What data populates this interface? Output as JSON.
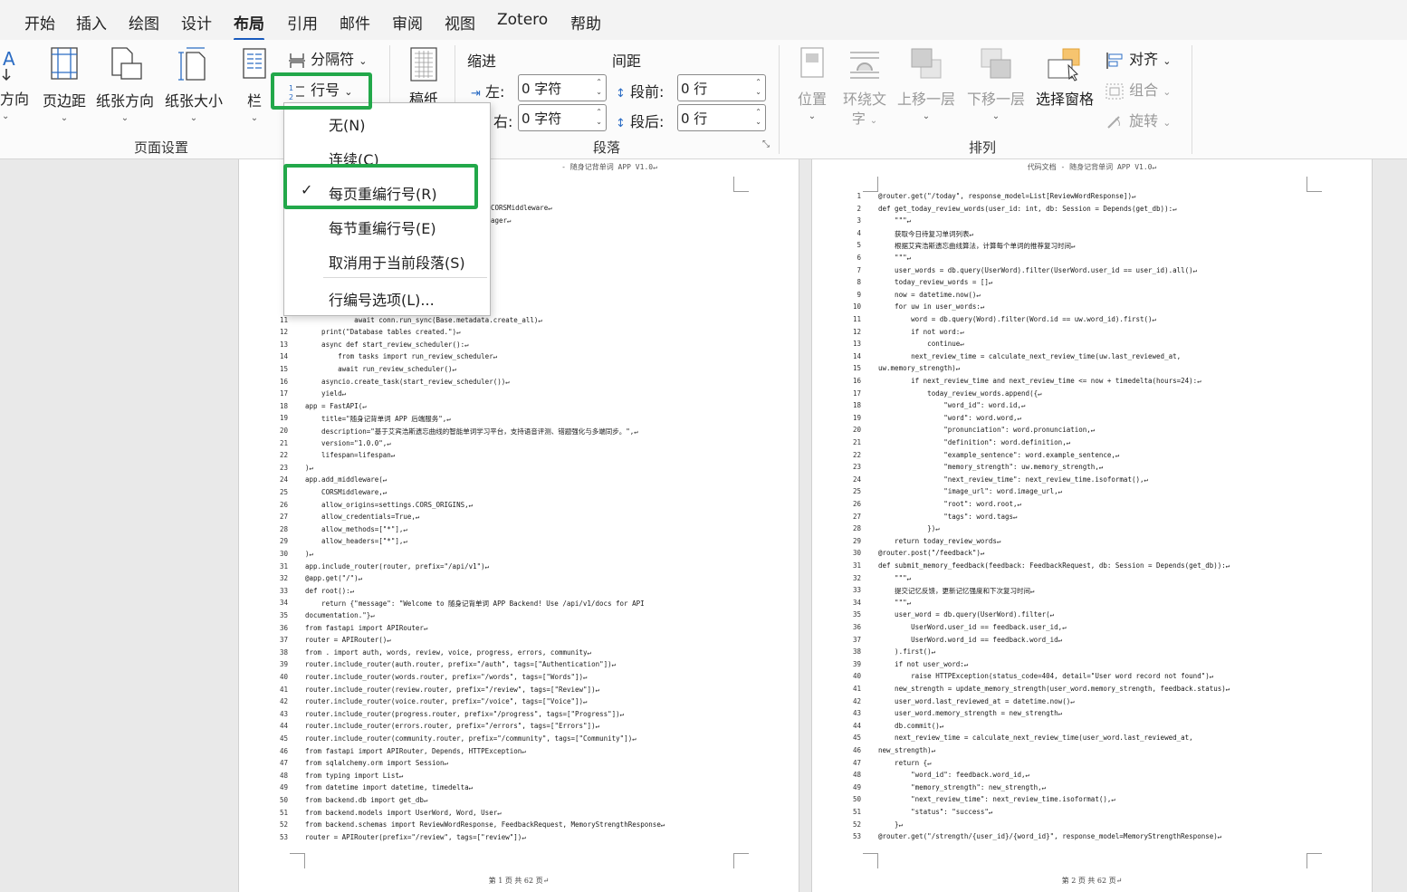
{
  "menu": [
    "开始",
    "插入",
    "绘图",
    "设计",
    "布局",
    "引用",
    "邮件",
    "审阅",
    "视图",
    "Zotero",
    "帮助"
  ],
  "active_menu": "布局",
  "ribbon": {
    "page_setup": {
      "text_direction": "方向",
      "margins": "页边距",
      "orientation": "纸张方向",
      "size": "纸张大小",
      "columns": "栏",
      "breaks": "分隔符",
      "line_numbers": "行号",
      "group_label": "页面设置"
    },
    "draft_paper": "稿纸",
    "paragraph": {
      "indent_label": "缩进",
      "spacing_label": "间距",
      "left_label": "左:",
      "left_value": "0 字符",
      "right_label": "右:",
      "right_value": "0 字符",
      "before_label": "段前:",
      "before_value": "0 行",
      "after_label": "段后:",
      "after_value": "0 行",
      "group_label": "段落"
    },
    "arrange": {
      "position": "位置",
      "wrap_text_1": "环绕文",
      "wrap_text_2": "字",
      "bring_forward": "上移一层",
      "send_backward": "下移一层",
      "selection_pane": "选择窗格",
      "align": "对齐",
      "group": "组合",
      "rotate": "旋转",
      "group_label": "排列"
    }
  },
  "dropdown": {
    "items": [
      {
        "label": "无(N)",
        "checked": false
      },
      {
        "label": "连续(C)",
        "checked": false
      },
      {
        "label": "每页重编行号(R)",
        "checked": true
      },
      {
        "label": "每节重编行号(E)",
        "checked": false
      },
      {
        "label": "取消用于当前段落(S)",
        "checked": false
      }
    ],
    "options_label": "行编号选项(L)..."
  },
  "colors": {
    "highlight": "#22a84a",
    "accent": "#185abd"
  },
  "page1": {
    "header": "- 随身记背单词 APP V1.0↵",
    "footer": "第 1 页 共 62 页↵",
    "top_fragments": [
      "CORSMiddleware↵",
      "ager↵"
    ],
    "lines": [
      {
        "n": "1",
        "t": ""
      },
      {
        "n": "11",
        "t": "            await conn.run_sync(Base.metadata.create_all)↵"
      },
      {
        "n": "12",
        "t": "    print(\"Database tables created.\")↵"
      },
      {
        "n": "13",
        "t": "    async def start_review_scheduler():↵"
      },
      {
        "n": "14",
        "t": "        from tasks import run_review_scheduler↵"
      },
      {
        "n": "15",
        "t": "        await run_review_scheduler()↵"
      },
      {
        "n": "16",
        "t": "    asyncio.create_task(start_review_scheduler())↵"
      },
      {
        "n": "17",
        "t": "    yield↵"
      },
      {
        "n": "18",
        "t": "app = FastAPI(↵"
      },
      {
        "n": "19",
        "t": "    title=\"随身记背单词 APP 后端服务\",↵"
      },
      {
        "n": "20",
        "t": "    description=\"基于艾宾浩斯遗忘曲线的智能单词学习平台，支持语音评测、错题强化与多端同步。\",↵"
      },
      {
        "n": "21",
        "t": "    version=\"1.0.0\",↵"
      },
      {
        "n": "22",
        "t": "    lifespan=lifespan↵"
      },
      {
        "n": "23",
        "t": ")↵"
      },
      {
        "n": "24",
        "t": "app.add_middleware(↵"
      },
      {
        "n": "25",
        "t": "    CORSMiddleware,↵"
      },
      {
        "n": "26",
        "t": "    allow_origins=settings.CORS_ORIGINS,↵"
      },
      {
        "n": "27",
        "t": "    allow_credentials=True,↵"
      },
      {
        "n": "28",
        "t": "    allow_methods=[\"*\"],↵"
      },
      {
        "n": "29",
        "t": "    allow_headers=[\"*\"],↵"
      },
      {
        "n": "30",
        "t": ")↵"
      },
      {
        "n": "31",
        "t": "app.include_router(router, prefix=\"/api/v1\")↵"
      },
      {
        "n": "32",
        "t": "@app.get(\"/\")↵"
      },
      {
        "n": "33",
        "t": "def root():↵"
      },
      {
        "n": "34",
        "t": "    return {\"message\": \"Welcome to 随身记背单词 APP Backend! Use /api/v1/docs for API"
      },
      {
        "n": "35",
        "t": "documentation.\"}↵"
      },
      {
        "n": "36",
        "t": "from fastapi import APIRouter↵"
      },
      {
        "n": "37",
        "t": "router = APIRouter()↵"
      },
      {
        "n": "38",
        "t": "from . import auth, words, review, voice, progress, errors, community↵"
      },
      {
        "n": "39",
        "t": "router.include_router(auth.router, prefix=\"/auth\", tags=[\"Authentication\"])↵"
      },
      {
        "n": "40",
        "t": "router.include_router(words.router, prefix=\"/words\", tags=[\"Words\"])↵"
      },
      {
        "n": "41",
        "t": "router.include_router(review.router, prefix=\"/review\", tags=[\"Review\"])↵"
      },
      {
        "n": "42",
        "t": "router.include_router(voice.router, prefix=\"/voice\", tags=[\"Voice\"])↵"
      },
      {
        "n": "43",
        "t": "router.include_router(progress.router, prefix=\"/progress\", tags=[\"Progress\"])↵"
      },
      {
        "n": "44",
        "t": "router.include_router(errors.router, prefix=\"/errors\", tags=[\"Errors\"])↵"
      },
      {
        "n": "45",
        "t": "router.include_router(community.router, prefix=\"/community\", tags=[\"Community\"])↵"
      },
      {
        "n": "46",
        "t": "from fastapi import APIRouter, Depends, HTTPException↵"
      },
      {
        "n": "47",
        "t": "from sqlalchemy.orm import Session↵"
      },
      {
        "n": "48",
        "t": "from typing import List↵"
      },
      {
        "n": "49",
        "t": "from datetime import datetime, timedelta↵"
      },
      {
        "n": "50",
        "t": "from backend.db import get_db↵"
      },
      {
        "n": "51",
        "t": "from backend.models import UserWord, Word, User↵"
      },
      {
        "n": "52",
        "t": "from backend.schemas import ReviewWordResponse, FeedbackRequest, MemoryStrengthResponse↵"
      },
      {
        "n": "53",
        "t": "router = APIRouter(prefix=\"/review\", tags=[\"review\"])↵"
      }
    ]
  },
  "page2": {
    "header": "代码文档 - 随身记背单词 APP V1.0↵",
    "footer": "第 2 页 共 62 页↵",
    "lines": [
      {
        "n": "1",
        "t": "@router.get(\"/today\", response_model=List[ReviewWordResponse])↵"
      },
      {
        "n": "2",
        "t": "def get_today_review_words(user_id: int, db: Session = Depends(get_db)):↵"
      },
      {
        "n": "3",
        "t": "    \"\"\"↵"
      },
      {
        "n": "4",
        "t": "    获取今日待复习单词列表↵"
      },
      {
        "n": "5",
        "t": "    根据艾宾浩斯遗忘曲线算法，计算每个单词的推荐复习时间↵"
      },
      {
        "n": "6",
        "t": "    \"\"\"↵"
      },
      {
        "n": "7",
        "t": "    user_words = db.query(UserWord).filter(UserWord.user_id == user_id).all()↵"
      },
      {
        "n": "8",
        "t": "    today_review_words = []↵"
      },
      {
        "n": "9",
        "t": "    now = datetime.now()↵"
      },
      {
        "n": "10",
        "t": "    for uw in user_words:↵"
      },
      {
        "n": "11",
        "t": "        word = db.query(Word).filter(Word.id == uw.word_id).first()↵"
      },
      {
        "n": "12",
        "t": "        if not word:↵"
      },
      {
        "n": "13",
        "t": "            continue↵"
      },
      {
        "n": "14",
        "t": "        next_review_time = calculate_next_review_time(uw.last_reviewed_at,"
      },
      {
        "n": "15",
        "t": "uw.memory_strength)↵"
      },
      {
        "n": "16",
        "t": "        if next_review_time and next_review_time <= now + timedelta(hours=24):↵"
      },
      {
        "n": "17",
        "t": "            today_review_words.append({↵"
      },
      {
        "n": "18",
        "t": "                \"word_id\": word.id,↵"
      },
      {
        "n": "19",
        "t": "                \"word\": word.word,↵"
      },
      {
        "n": "20",
        "t": "                \"pronunciation\": word.pronunciation,↵"
      },
      {
        "n": "21",
        "t": "                \"definition\": word.definition,↵"
      },
      {
        "n": "22",
        "t": "                \"example_sentence\": word.example_sentence,↵"
      },
      {
        "n": "23",
        "t": "                \"memory_strength\": uw.memory_strength,↵"
      },
      {
        "n": "24",
        "t": "                \"next_review_time\": next_review_time.isoformat(),↵"
      },
      {
        "n": "25",
        "t": "                \"image_url\": word.image_url,↵"
      },
      {
        "n": "26",
        "t": "                \"root\": word.root,↵"
      },
      {
        "n": "27",
        "t": "                \"tags\": word.tags↵"
      },
      {
        "n": "28",
        "t": "            })↵"
      },
      {
        "n": "29",
        "t": "    return today_review_words↵"
      },
      {
        "n": "30",
        "t": "@router.post(\"/feedback\")↵"
      },
      {
        "n": "31",
        "t": "def submit_memory_feedback(feedback: FeedbackRequest, db: Session = Depends(get_db)):↵"
      },
      {
        "n": "32",
        "t": "    \"\"\"↵"
      },
      {
        "n": "33",
        "t": "    提交记忆反馈，更新记忆强度和下次复习时间↵"
      },
      {
        "n": "34",
        "t": "    \"\"\"↵"
      },
      {
        "n": "35",
        "t": "    user_word = db.query(UserWord).filter(↵"
      },
      {
        "n": "36",
        "t": "        UserWord.user_id == feedback.user_id,↵"
      },
      {
        "n": "37",
        "t": "        UserWord.word_id == feedback.word_id↵"
      },
      {
        "n": "38",
        "t": "    ).first()↵"
      },
      {
        "n": "39",
        "t": "    if not user_word:↵"
      },
      {
        "n": "40",
        "t": "        raise HTTPException(status_code=404, detail=\"User word record not found\")↵"
      },
      {
        "n": "41",
        "t": "    new_strength = update_memory_strength(user_word.memory_strength, feedback.status)↵"
      },
      {
        "n": "42",
        "t": "    user_word.last_reviewed_at = datetime.now()↵"
      },
      {
        "n": "43",
        "t": "    user_word.memory_strength = new_strength↵"
      },
      {
        "n": "44",
        "t": "    db.commit()↵"
      },
      {
        "n": "45",
        "t": "    next_review_time = calculate_next_review_time(user_word.last_reviewed_at,"
      },
      {
        "n": "46",
        "t": "new_strength)↵"
      },
      {
        "n": "47",
        "t": "    return {↵"
      },
      {
        "n": "48",
        "t": "        \"word_id\": feedback.word_id,↵"
      },
      {
        "n": "49",
        "t": "        \"memory_strength\": new_strength,↵"
      },
      {
        "n": "50",
        "t": "        \"next_review_time\": next_review_time.isoformat(),↵"
      },
      {
        "n": "51",
        "t": "        \"status\": \"success\"↵"
      },
      {
        "n": "52",
        "t": "    }↵"
      },
      {
        "n": "53",
        "t": "@router.get(\"/strength/{user_id}/{word_id}\", response_model=MemoryStrengthResponse)↵"
      }
    ]
  }
}
